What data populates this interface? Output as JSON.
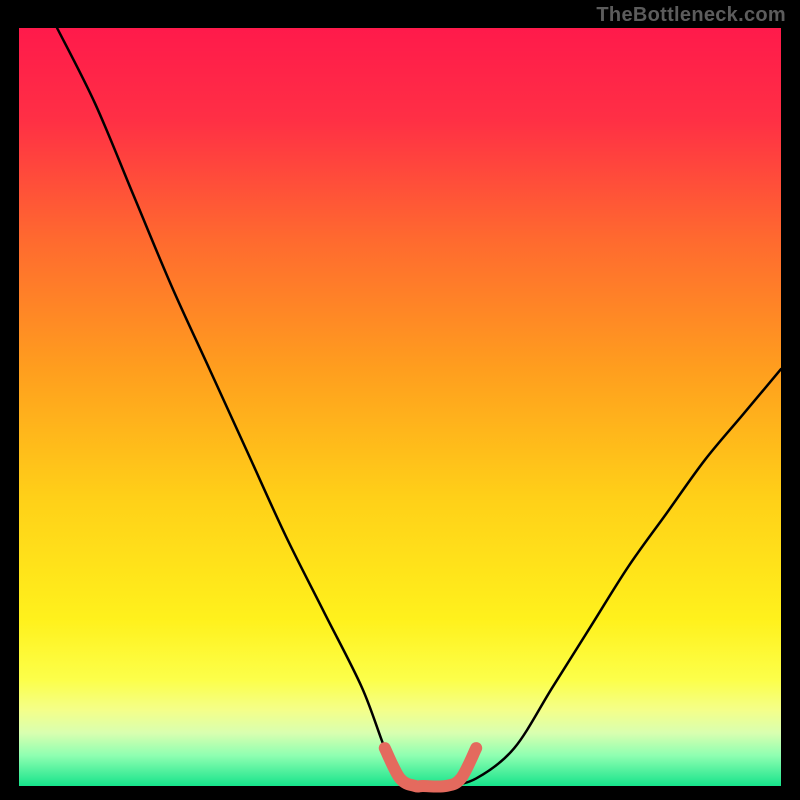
{
  "watermark": "TheBottleneck.com",
  "chart_data": {
    "type": "line",
    "title": "",
    "xlabel": "",
    "ylabel": "",
    "xlim": [
      0,
      100
    ],
    "ylim": [
      0,
      100
    ],
    "series": [
      {
        "name": "bottleneck-curve",
        "x": [
          5,
          10,
          15,
          20,
          25,
          30,
          35,
          40,
          45,
          48,
          50,
          53,
          56,
          60,
          65,
          70,
          75,
          80,
          85,
          90,
          95,
          100
        ],
        "values": [
          100,
          90,
          78,
          66,
          55,
          44,
          33,
          23,
          13,
          5,
          1,
          0,
          0,
          1,
          5,
          13,
          21,
          29,
          36,
          43,
          49,
          55
        ]
      },
      {
        "name": "salmon-segment",
        "x": [
          48,
          50,
          52,
          53,
          56,
          58,
          60
        ],
        "values": [
          5,
          1,
          0,
          0,
          0,
          1,
          5
        ]
      }
    ],
    "gradient_stops": [
      {
        "offset": 0.0,
        "color": "#ff1a4b"
      },
      {
        "offset": 0.12,
        "color": "#ff2f45"
      },
      {
        "offset": 0.28,
        "color": "#ff6a2f"
      },
      {
        "offset": 0.45,
        "color": "#ff9e1e"
      },
      {
        "offset": 0.62,
        "color": "#ffd018"
      },
      {
        "offset": 0.78,
        "color": "#fff11c"
      },
      {
        "offset": 0.86,
        "color": "#fcff4a"
      },
      {
        "offset": 0.9,
        "color": "#f4ff8a"
      },
      {
        "offset": 0.93,
        "color": "#d9ffb0"
      },
      {
        "offset": 0.96,
        "color": "#8effb1"
      },
      {
        "offset": 1.0,
        "color": "#16e38b"
      }
    ],
    "colors": {
      "background": "#000000",
      "curve": "#000000",
      "segment": "#e46a5e"
    }
  }
}
